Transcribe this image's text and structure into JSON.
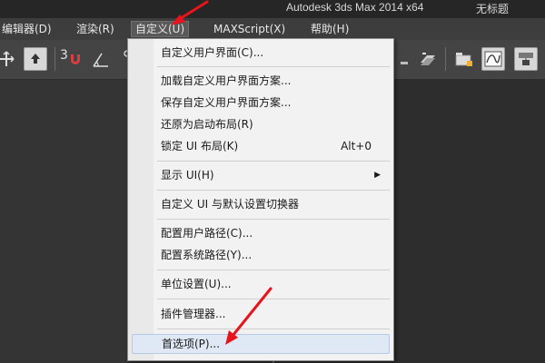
{
  "title_bar": {
    "app_title": "Autodesk 3ds Max  2014 x64",
    "document_title": "无标题"
  },
  "menubar": {
    "items": [
      {
        "label": "编辑器(D)"
      },
      {
        "label": "渲染(R)"
      },
      {
        "label": "自定义(U)"
      },
      {
        "label": "MAXScript(X)"
      },
      {
        "label": "帮助(H)"
      }
    ]
  },
  "toolbar": {
    "snap_label": "3"
  },
  "dropdown": {
    "items": [
      {
        "label": "自定义用户界面(C)..."
      },
      {
        "label": "加载自定义用户界面方案..."
      },
      {
        "label": "保存自定义用户界面方案..."
      },
      {
        "label": "还原为启动布局(R)"
      },
      {
        "label": "锁定 UI 布局(K)",
        "shortcut": "Alt+0"
      },
      {
        "label": "显示 UI(H)",
        "submenu_arrow": "▶"
      },
      {
        "label": "自定义 UI 与默认设置切换器"
      },
      {
        "label": "配置用户路径(C)..."
      },
      {
        "label": "配置系统路径(Y)..."
      },
      {
        "label": "单位设置(U)..."
      },
      {
        "label": "插件管理器..."
      },
      {
        "label": "首选项(P)..."
      }
    ]
  },
  "colors": {
    "annotation_arrow": "#e8141c",
    "menu_background": "#f2f2f2",
    "hover_highlight": "#dfe8f5"
  }
}
